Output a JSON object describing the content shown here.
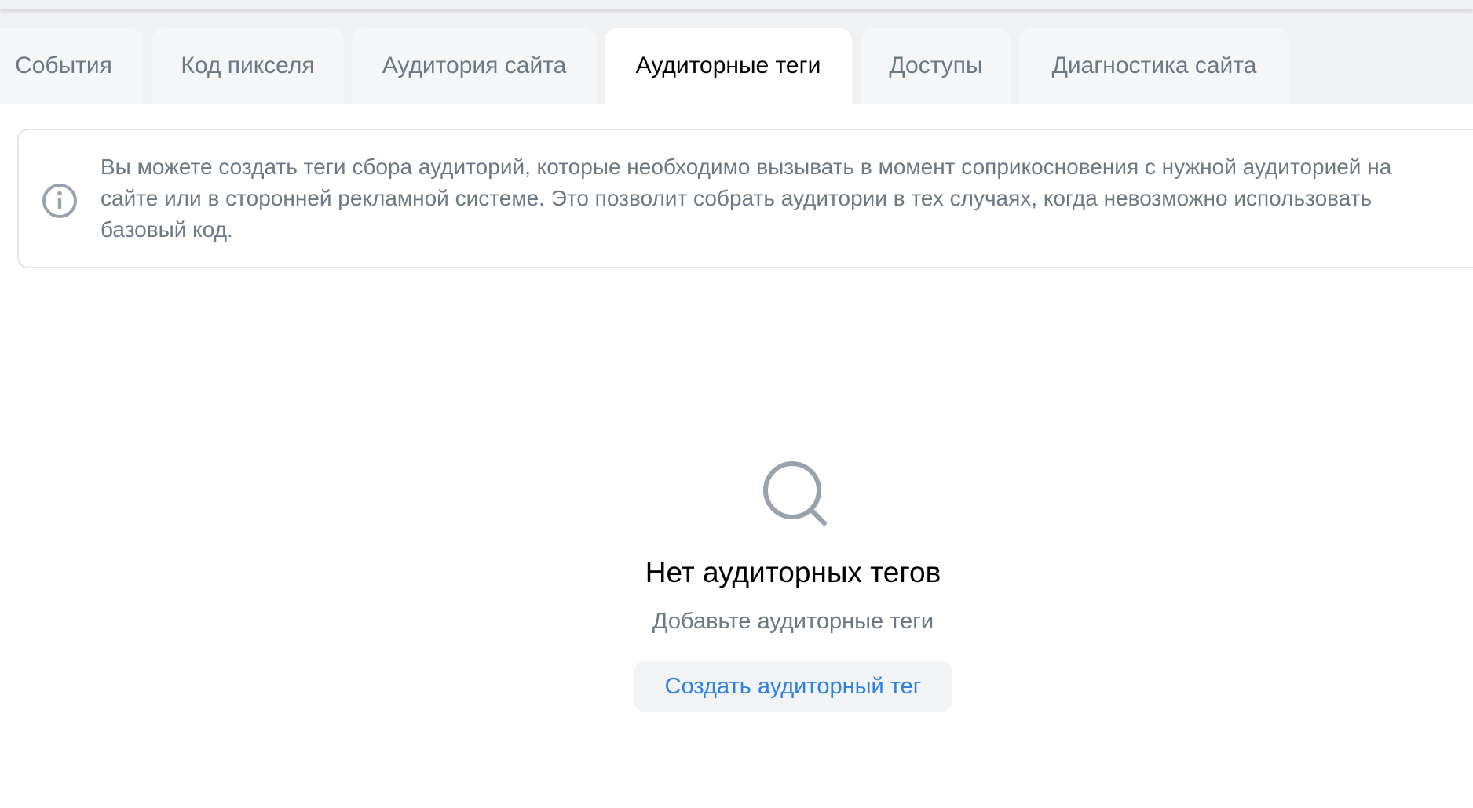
{
  "tabs": [
    {
      "label": "События"
    },
    {
      "label": "Код пикселя"
    },
    {
      "label": "Аудитория сайта"
    },
    {
      "label": "Аудиторные теги",
      "active": true
    },
    {
      "label": "Доступы"
    },
    {
      "label": "Диагностика сайта"
    }
  ],
  "info": {
    "icon": "info-icon",
    "text": "Вы можете создать теги сбора аудиторий, которые необходимо вызывать в момент соприкосновения с нужной аудиторией на сайте или в сторонней рекламной системе. Это позволит собрать аудитории в тех случаях, когда невозможно использовать базовый код."
  },
  "empty_state": {
    "icon": "search-icon",
    "title": "Нет аудиторных тегов",
    "subtitle": "Добавьте аудиторные теги",
    "button_label": "Создать аудиторный тег"
  },
  "colors": {
    "accent": "#2d81e0",
    "secondary_text": "#6d7885",
    "icon_gray": "#99a2ad"
  }
}
